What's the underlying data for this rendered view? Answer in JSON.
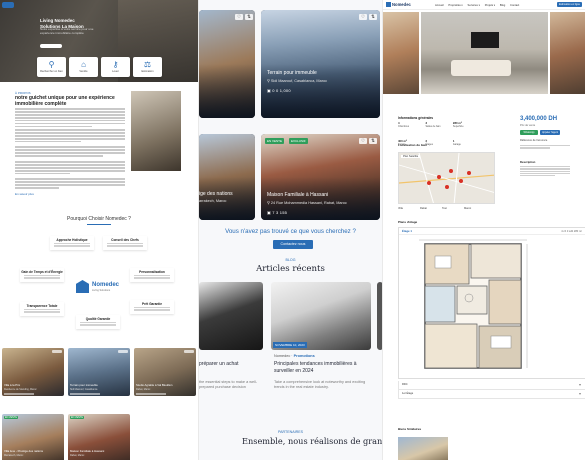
{
  "pane_a": {
    "hero": {
      "title_line1": "Living Nomedec",
      "title_line2": "Solutions La Maison",
      "subtitle": "Notre expertise à votre service pour une expérience immobilière complète",
      "quick_links": [
        {
          "icon": "search-icon",
          "label": "Rechercher un bien"
        },
        {
          "icon": "home-icon",
          "label": "Vendre"
        },
        {
          "icon": "key-icon",
          "label": "Louer"
        },
        {
          "icon": "handshake-icon",
          "label": "Estimation"
        }
      ]
    },
    "about": {
      "kicker": "À PROPOS",
      "title": "notre guichet unique pour une expérience immobilière complète",
      "link": "En savoir plus"
    },
    "why": {
      "title": "Pourquoi Choisir Nomedec ?",
      "features": [
        {
          "title": "Approche Holistique",
          "name": "feature-holistic"
        },
        {
          "title": "Conseil des Chefs",
          "name": "feature-advice"
        },
        {
          "title": "Gain de Temps et d'Énergie",
          "name": "feature-time"
        },
        {
          "title": "Personnalisation",
          "name": "feature-custom"
        },
        {
          "title": "Transparence Totale",
          "name": "feature-transparency"
        },
        {
          "title": "Qualité Garantie",
          "name": "feature-quality"
        },
        {
          "title": "Prêt Garantie",
          "name": "feature-loan"
        }
      ],
      "logo_title": "Nomedec",
      "logo_sub": "Living Solutions"
    },
    "cards": [
      {
        "label": "Villa à la Prix",
        "loc": "Residence de Standing, Maroc"
      },
      {
        "label": "Terrain pour immeuble",
        "loc": "Sidi Maarouf, Casablanca"
      },
      {
        "label": "Studio Agrable à Val Bleullion",
        "loc": "Rabat, Maroc"
      },
      {
        "label": "Villa luxe - Prestige des nations",
        "loc": "Marrakech, Maroc",
        "tag": "EN VENTE"
      },
      {
        "label": "Maison Familiale à Hassani",
        "loc": "Rabat, Maroc",
        "tag": "EN VENTE"
      }
    ]
  },
  "pane_b": {
    "cards": [
      {
        "title": "Terrain pour immeuble",
        "addr": "Sidi Maarouf, Casablanca, Maroc",
        "meta": "0   0   1,000"
      },
      {
        "title": "ige des nations",
        "addr": "arrakech, Maroc",
        "meta": ""
      },
      {
        "title": "Maison Familiale à Hassani",
        "addr": "24 Rue Mohammedia Hassani, Rabat, Maroc",
        "meta": "7   3   155"
      }
    ],
    "tags": {
      "sale": "EN VENTE",
      "exclusive": "EXCLUSIF"
    },
    "question": "Vous n'avez pas trouvé ce que vous cherchez ?",
    "contact_label": "Contactez nous",
    "blog_kicker": "BLOG",
    "blog_title": "Articles récents",
    "articles": [
      {
        "title": "préparer un achat",
        "excerpt": "the essential steps to make a well-prepared purchase decision",
        "date": ""
      },
      {
        "title": "Principales tendances immobilières à surveiller en 2024",
        "excerpt": "Take a comprehensive look at noteworthy and exciting trends in the real estate industry.",
        "date": "NOVEMBRE 10, 2023"
      }
    ],
    "article_cat_author": "Nomedec",
    "article_cat": "Promotions",
    "partners_kicker": "PARTENAIRES",
    "partners_title": "Ensemble, nous réalisons de grandes cl"
  },
  "pane_c": {
    "nav": {
      "brand": "Nomedec",
      "menu": [
        "Accueil",
        "Propriétés ▾",
        "Services ▾",
        "Projets ▾",
        "Blog",
        "Contact"
      ],
      "cta": "Estimation en ligne"
    },
    "info_title": "Informations générales",
    "info_cells": [
      {
        "label": "Chambres",
        "value": "4"
      },
      {
        "label": "Salles de bain",
        "value": "3"
      },
      {
        "label": "Superficie",
        "value": "280 m²"
      },
      {
        "label": "Terrain",
        "value": "400 m²"
      },
      {
        "label": "Étages",
        "value": "2"
      },
      {
        "label": "Garage",
        "value": "1"
      },
      {
        "label": "Type",
        "value": "Villa"
      },
      {
        "label": "Année",
        "value": "2019"
      }
    ],
    "price": "3,400,000 DH",
    "price_sub": "Prix de vente",
    "whatsapp": "WhatsApp",
    "call": "Appeler l'agent",
    "ref": "Référence de l'annonce",
    "description_title": "Description",
    "location_title": "Localisation du bien",
    "map_tabs": "Plan  Satellite",
    "stats": [
      "Villa",
      "Rabat",
      "Tout",
      "Maroc"
    ],
    "plan_title": "Plans d'étage",
    "plan_tab": "Étage 1",
    "plan_meta": "4 ch   3 sdb   280 m²",
    "rows": [
      "RDC",
      "1er Étage"
    ],
    "similar": "Biens Similaires"
  }
}
